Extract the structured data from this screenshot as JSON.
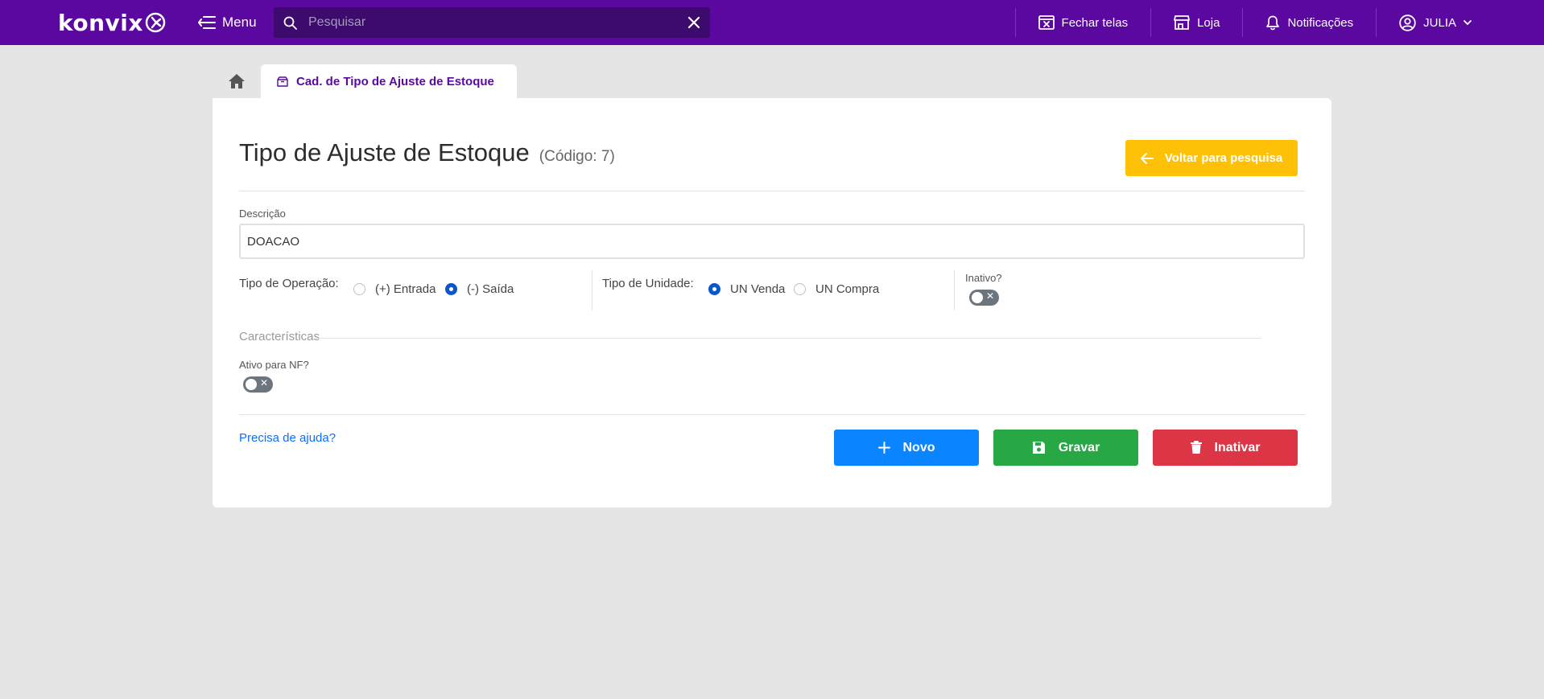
{
  "topbar": {
    "logo_text": "Konvix",
    "menu_label": "Menu",
    "search_placeholder": "Pesquisar",
    "close_screens_label": "Fechar telas",
    "store_label": "Loja",
    "notifications_label": "Notificações",
    "user_label": "JULIA"
  },
  "tabs": {
    "active_label": "Cad. de Tipo de Ajuste de Estoque"
  },
  "page": {
    "title": "Tipo de Ajuste de Estoque",
    "code": "(Código: 7)",
    "back_button": "Voltar para pesquisa"
  },
  "form": {
    "descricao_label": "Descrição",
    "descricao_value": "DOACAO",
    "tipo_operacao_label": "Tipo de Operação:",
    "tipo_operacao_options": [
      "(+) Entrada",
      "(-) Saída"
    ],
    "tipo_operacao_selected": "(-) Saída",
    "tipo_unidade_label": "Tipo de Unidade:",
    "tipo_unidade_options": [
      "UN Venda",
      "UN Compra"
    ],
    "tipo_unidade_selected": "UN Venda",
    "inativo_label": "Inativo?",
    "inativo_value": false,
    "caracteristicas_label": "Características",
    "ativo_nf_label": "Ativo para NF?",
    "ativo_nf_value": false
  },
  "footer": {
    "help_link": "Precisa de ajuda?",
    "new_button": "Novo",
    "save_button": "Gravar",
    "inactivate_button": "Inativar"
  },
  "colors": {
    "topbar": "#5a08a0",
    "search_bg": "#3d0a6e",
    "back_button": "#ffc107",
    "new_button": "#0b84ff",
    "save_button": "#28a745",
    "inactivate_button": "#dc3545",
    "radio_checked": "#0d56c9"
  }
}
